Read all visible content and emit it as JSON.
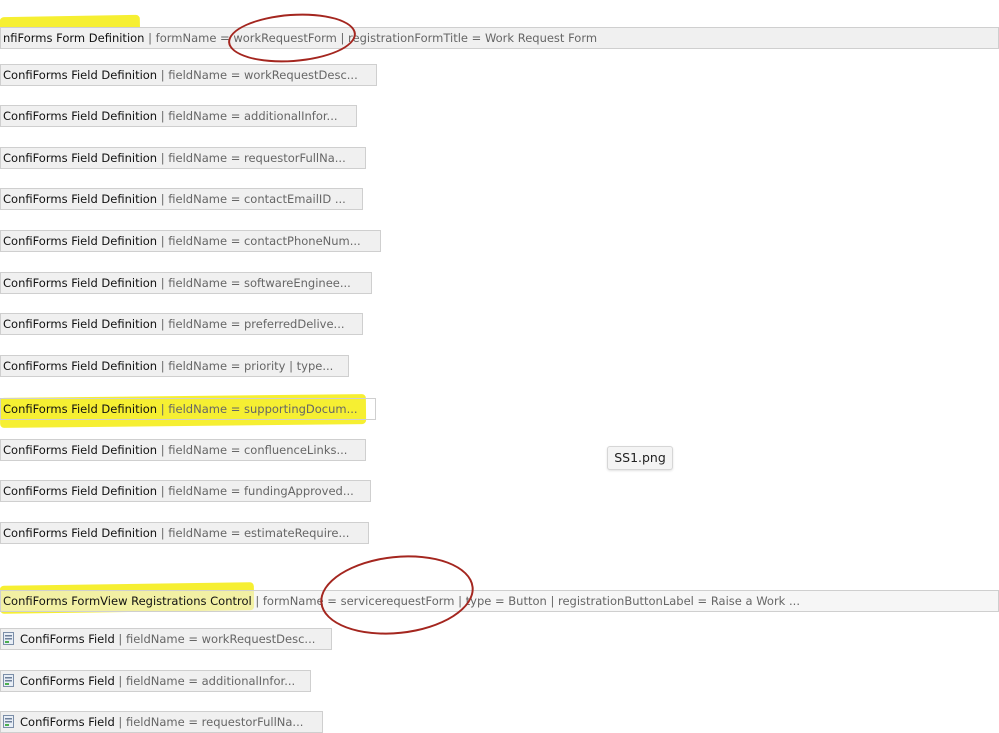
{
  "form_definition": {
    "name": "nfiForms Form Definition",
    "params": " | formName = workRequestForm | registrationFormTitle = Work Request Form"
  },
  "field_definitions": [
    {
      "name": "ConfiForms Field Definition",
      "params": " | fieldName = workRequestDesc..."
    },
    {
      "name": "ConfiForms Field Definition",
      "params": " | fieldName = additionalInfor..."
    },
    {
      "name": "ConfiForms Field Definition",
      "params": " | fieldName = requestorFullNa..."
    },
    {
      "name": "ConfiForms Field Definition",
      "params": " | fieldName = contactEmailID ..."
    },
    {
      "name": "ConfiForms Field Definition",
      "params": " | fieldName = contactPhoneNum..."
    },
    {
      "name": "ConfiForms Field Definition",
      "params": " | fieldName = softwareEnginee..."
    },
    {
      "name": "ConfiForms Field Definition",
      "params": " | fieldName = preferredDelive..."
    },
    {
      "name": "ConfiForms Field Definition",
      "params": " | fieldName = priority | type..."
    },
    {
      "name": "ConfiForms Field Definition",
      "params": " | fieldName = supportingDocum..."
    },
    {
      "name": "ConfiForms Field Definition",
      "params": " | fieldName = confluenceLinks..."
    },
    {
      "name": "ConfiForms Field Definition",
      "params": " | fieldName = fundingApproved..."
    },
    {
      "name": "ConfiForms Field Definition",
      "params": " | fieldName = estimateRequire..."
    }
  ],
  "registrations_control": {
    "name": "ConfiForms FormView Registrations Control",
    "params": " | formName = servicerequestForm | type = Button | registrationButtonLabel = Raise a Work ..."
  },
  "fields": [
    {
      "name": "ConfiForms Field",
      "params": " | fieldName = workRequestDesc..."
    },
    {
      "name": "ConfiForms Field",
      "params": " | fieldName = additionalInfor..."
    },
    {
      "name": "ConfiForms Field",
      "params": " | fieldName = requestorFullNa..."
    }
  ],
  "file_label": "SS1.png",
  "colors": {
    "highlight": "#f5ee27",
    "circle": "#a4261f",
    "macro_bg": "#f0f0f0"
  }
}
